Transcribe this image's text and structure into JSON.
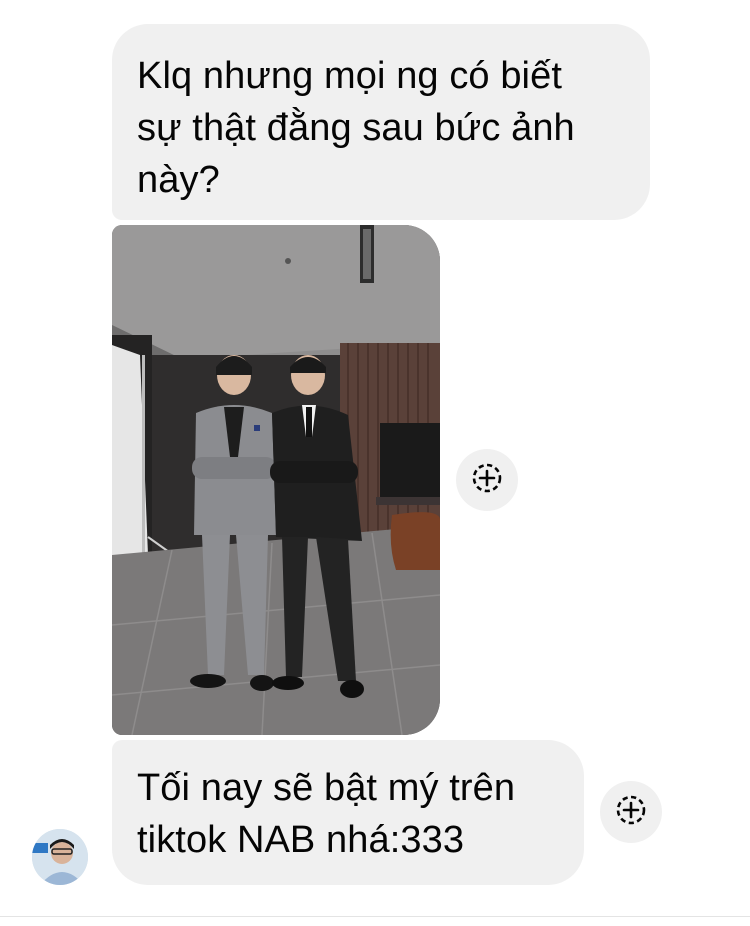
{
  "messages": [
    {
      "text": "Klq nhưng mọi ng có biết\nsự thật đằng sau bức ảnh\nnày?"
    },
    {
      "text": "Tối nay sẽ bật mý trên\ntiktok NAB nhá:333"
    }
  ],
  "icons": {
    "react": "add-reaction-icon",
    "avatar": "user-avatar"
  },
  "colors": {
    "bubble": "#f0f0f0",
    "text": "#050505",
    "icon": "#050505",
    "background": "#ffffff"
  }
}
